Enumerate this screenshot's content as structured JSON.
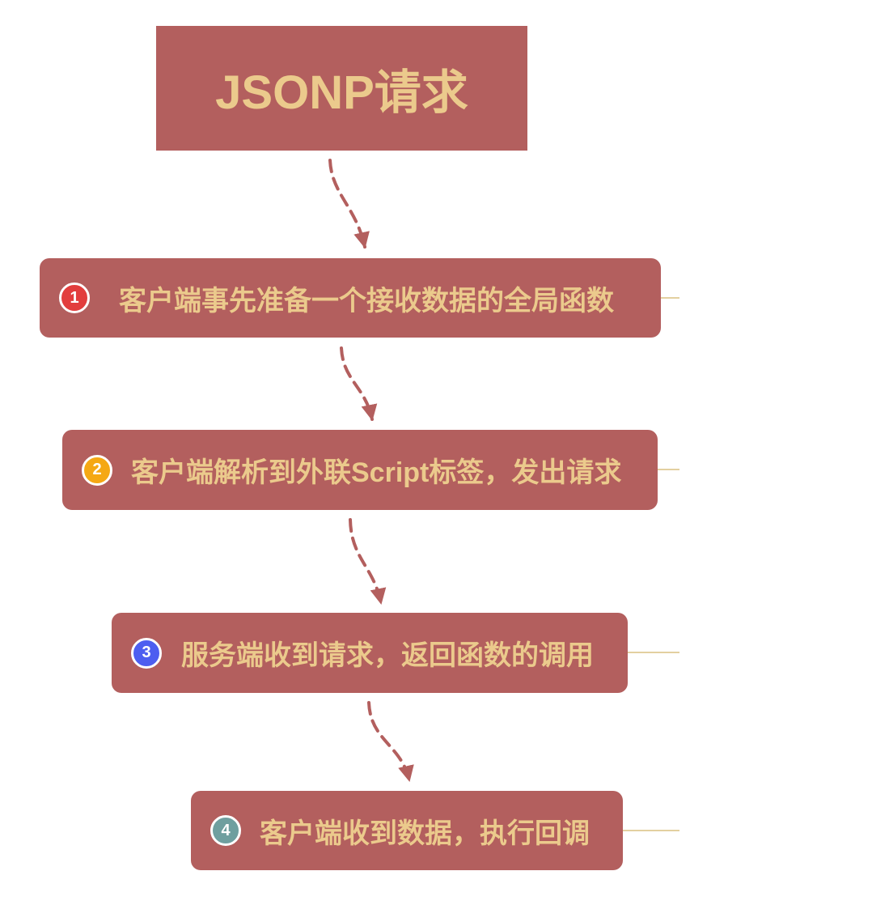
{
  "title": "JSONP请求",
  "steps": [
    {
      "number": "1",
      "text": "客户端事先准备一个接收数据的全局函数",
      "badge_color": "#e23d3d"
    },
    {
      "number": "2",
      "text": "客户端解析到外联Script标签，发出请求",
      "badge_color": "#f5a814"
    },
    {
      "number": "3",
      "text": "服务端收到请求，返回函数的调用",
      "badge_color": "#4d5ef0"
    },
    {
      "number": "4",
      "text": "客户端收到数据，执行回调",
      "badge_color": "#6f9f9f"
    }
  ],
  "colors": {
    "node_fill": "#b35f5e",
    "node_text": "#ebca8c",
    "arrow": "#b35f5e",
    "connector": "#e3d0a0"
  }
}
